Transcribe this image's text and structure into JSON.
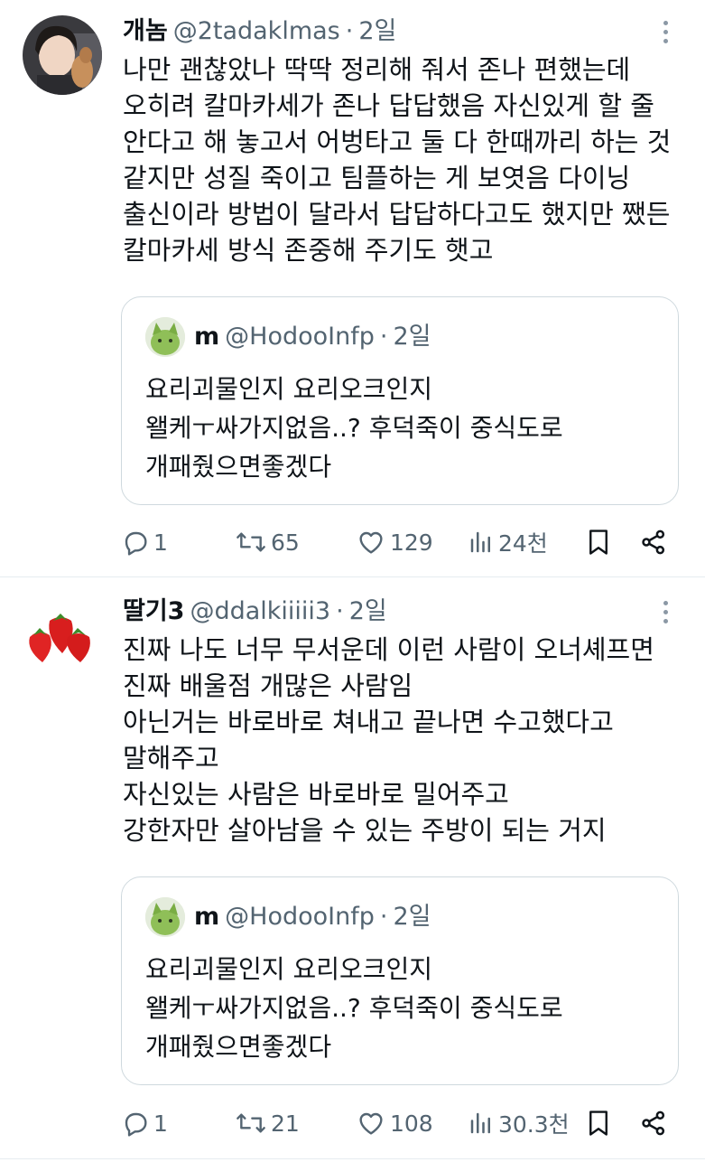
{
  "tweets": [
    {
      "name": "개놈",
      "handle": "@2tadaklmas",
      "time": "2일",
      "lines": [
        "나만 괜찮았나 딱딱 정리해 줘서 존나 편했는데",
        "오히려 칼마카세가 존나 답답했음 자신있게 할 줄",
        "안다고 해 놓고서 어벙타고 둘 다 한때까리 하는 것",
        "같지만 성질 죽이고 팀플하는 게 보엿음 다이닝",
        "출신이라 방법이 달라서 답답하다고도 했지만 쨌든",
        "칼마카세 방식 존중해 주기도 햇고"
      ],
      "quote": {
        "name": "m",
        "handle": "@HodooInfp",
        "time": "2일",
        "lines": [
          "요리괴물인지 요리오크인지",
          "왤케ㅜ싸가지없음..?  후덕죽이 중식도로",
          "개패줬으면좋겠다"
        ]
      },
      "stats": {
        "replies": "1",
        "retweets": "65",
        "likes": "129",
        "views": "24천"
      }
    },
    {
      "name": "딸기3",
      "handle": "@ddalkiiiii3",
      "time": "2일",
      "lines": [
        "진짜 나도 너무 무서운데 이런 사람이 오너셰프면",
        "진짜 배울점 개많은 사람임",
        "아닌거는 바로바로 쳐내고 끝나면 수고했다고",
        "말해주고",
        "자신있는 사람은 바로바로 밀어주고",
        "강한자만 살아남을 수 있는 주방이 되는 거지"
      ],
      "quote": {
        "name": "m",
        "handle": "@HodooInfp",
        "time": "2일",
        "lines": [
          "요리괴물인지 요리오크인지",
          "왤케ㅜ싸가지없음..?  후덕죽이 중식도로",
          "개패줬으면좋겠다"
        ]
      },
      "stats": {
        "replies": "1",
        "retweets": "21",
        "likes": "108",
        "views": "30.3천"
      }
    }
  ],
  "colors": {
    "text": "#0f1419",
    "secondary": "#536471",
    "border": "#cfd9de"
  },
  "icons": [
    "reply-icon",
    "retweet-icon",
    "like-icon",
    "views-icon",
    "bookmark-icon",
    "share-icon",
    "more-icon"
  ]
}
